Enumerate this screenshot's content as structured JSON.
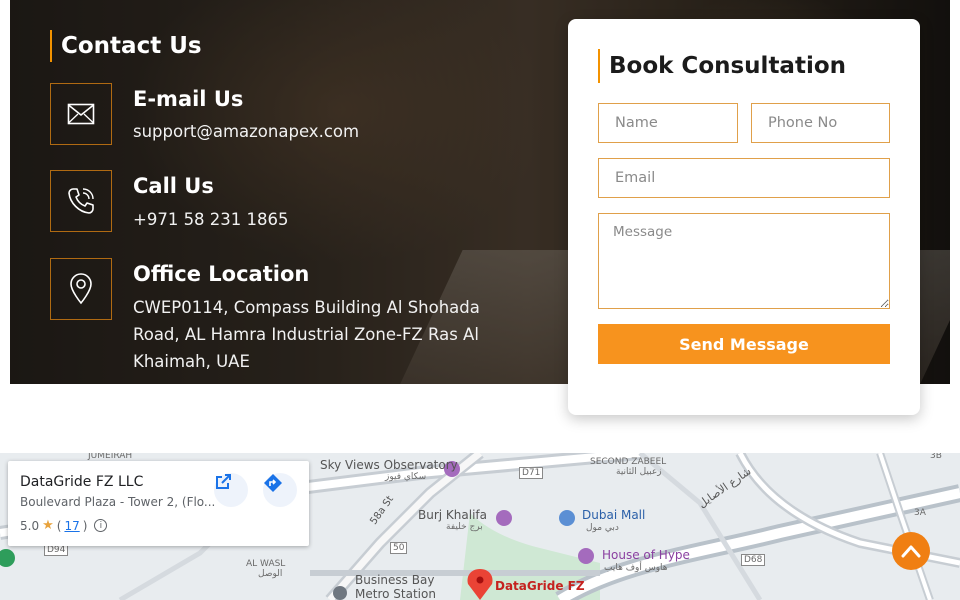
{
  "contact": {
    "heading": "Contact Us",
    "email": {
      "title": "E-mail Us",
      "value": "support@amazonapex.com",
      "icon": "envelope-icon"
    },
    "call": {
      "title": "Call Us",
      "value": "+971 58 231 1865",
      "icon": "phone-icon"
    },
    "office": {
      "title": "Office Location",
      "lines": [
        "CWEP0114, Compass Building Al Shohada",
        "Road, AL Hamra Industrial Zone-FZ Ras Al",
        "Khaimah, UAE"
      ],
      "icon": "location-pin-icon"
    }
  },
  "form": {
    "title": "Book Consultation",
    "name_placeholder": "Name",
    "phone_placeholder": "Phone No",
    "email_placeholder": "Email",
    "message_placeholder": "Message",
    "submit_label": "Send Message"
  },
  "map": {
    "place": {
      "name": "DataGride FZ LLC",
      "address": "Boulevard Plaza - Tower 2, (Flo...",
      "rating": "5.0",
      "reviews": "17"
    },
    "labels": {
      "jumeirah": "JUMEIRAH",
      "sky_views": "Sky Views Observatory",
      "sky_views_ar": "سكاي فيوز",
      "burj_khalifa": "Burj Khalifa",
      "burj_khalifa_ar": "برج خليفة",
      "dubai_mall": "Dubai Mall",
      "dubai_mall_ar": "دبي مول",
      "second_zabeel": "SECOND ZABEEL",
      "second_zabeel_ar": "زعبيل الثانية",
      "house_of_hype": "House of Hype",
      "house_of_hype_ar": "هاوس أوف هايب",
      "al_wasl": "AL WASL",
      "al_wasl_ar": "الوصل",
      "business_bay": "Business Bay",
      "metro_station": "Metro Station",
      "datagride": "DataGride FZ",
      "street_58a": "58a St",
      "road_d71": "D71",
      "road_d94": "D94",
      "road_50": "50",
      "road_d68": "D68",
      "road_3a": "3A",
      "road_3b": "3B",
      "asail_ar": "شارع الأصايل"
    }
  },
  "colors": {
    "accent": "#f7931e",
    "accent_border": "#e0a04a",
    "map_bg": "#e9eef0"
  }
}
